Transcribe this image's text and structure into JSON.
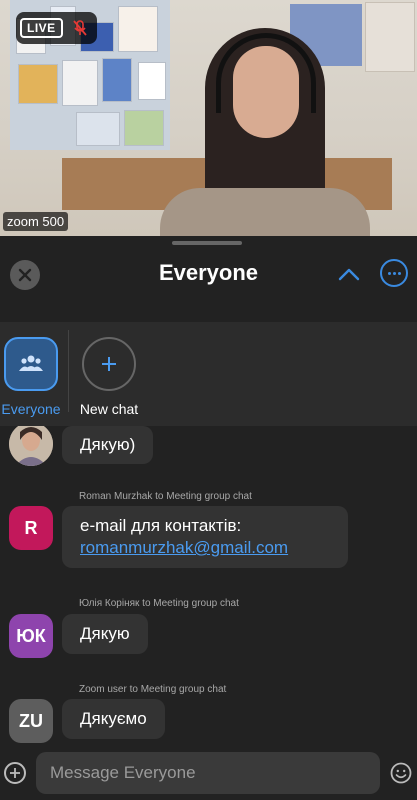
{
  "video": {
    "live_label": "LIVE",
    "participant_name": "zoom 500",
    "mic_icon": "mic-off-icon"
  },
  "header": {
    "title": "Everyone",
    "close_icon": "close-icon",
    "collapse_icon": "chevron-up-icon",
    "more_icon": "more-icon",
    "accent": "#3a8ae0"
  },
  "recipients": [
    {
      "label": "Everyone",
      "icon": "people-icon",
      "selected": true
    },
    {
      "label": "New chat",
      "icon": "plus-icon",
      "selected": false
    }
  ],
  "messages": [
    {
      "sender": "",
      "avatar": "",
      "avatar_color": "",
      "lines": [
        "Дякую)"
      ]
    },
    {
      "sender": "Roman Murzhak to Meeting group chat",
      "avatar": "R",
      "avatar_color": "#c2185b",
      "lines": [
        "e-mail для контактів:"
      ],
      "link": "romanmurzhak@gmail.com"
    },
    {
      "sender": "Юлія Коріняк to Meeting group chat",
      "avatar": "ЮК",
      "avatar_color": "#8e44ad",
      "lines": [
        "Дякую"
      ]
    },
    {
      "sender": "Zoom user to Meeting group chat",
      "avatar": "ZU",
      "avatar_color": "#5d5d5d",
      "lines": [
        "Дякуємо"
      ]
    }
  ],
  "composer": {
    "placeholder": "Message Everyone",
    "value": ""
  }
}
